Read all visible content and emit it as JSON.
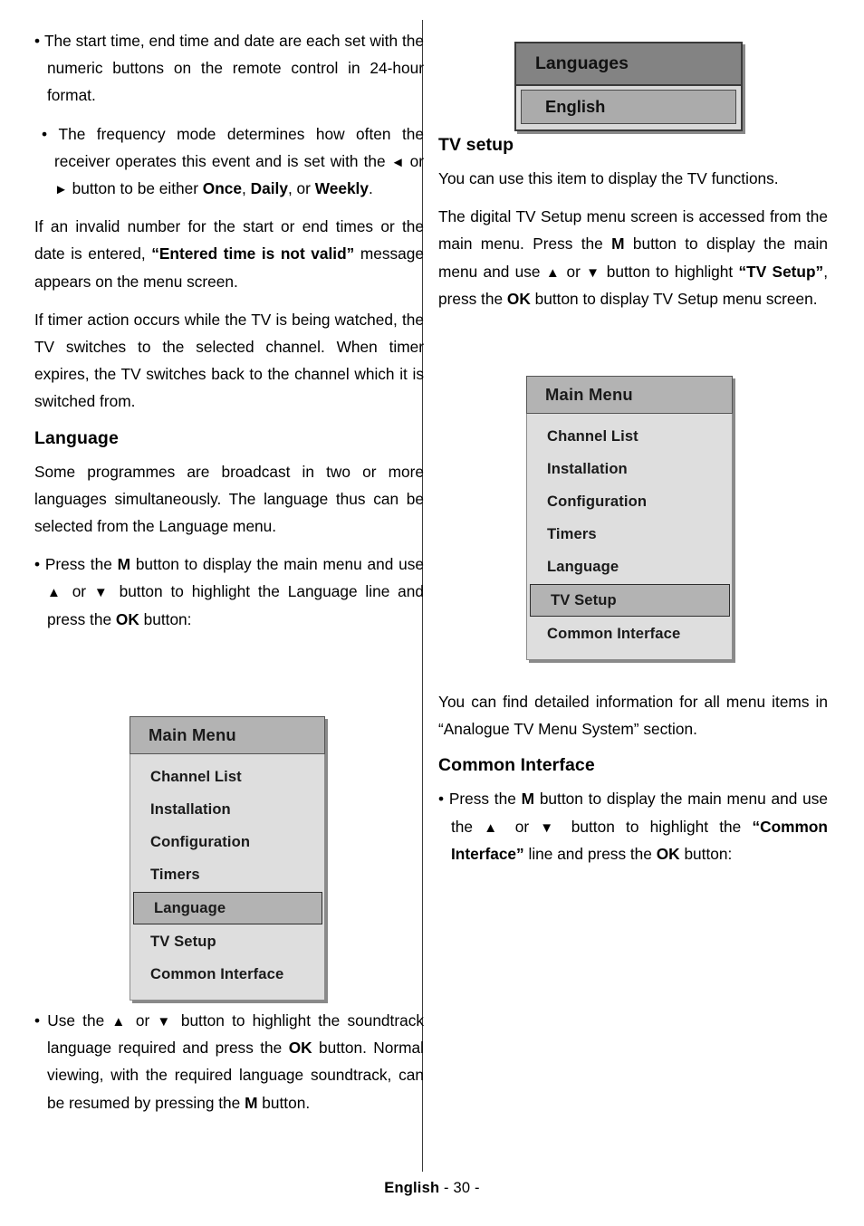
{
  "page": {
    "footer_language": "English",
    "footer_page": " - 30 -"
  },
  "left_column": {
    "b1_pre": "The start time, end time and date are each set with the numeric buttons on the remote control in 24-hour format.",
    "b2_pre": "The frequency mode determines how often the receiver operates this event and is set with the ",
    "b2_arrow_left": "◄",
    "b2_mid1": " or ",
    "b2_arrow_right": "►",
    "b2_mid2": " button to be either ",
    "b2_bold1": "Once",
    "b2_mid3": ", ",
    "b2_bold2": "Daily",
    "b2_mid4": ", or ",
    "b2_bold3": "Weekly",
    "b2_end": ".",
    "p1_pre": "If an invalid number for the start or end times or the date is entered, ",
    "p1_bold": "“Entered time is not valid”",
    "p1_post": " message appears on the menu screen.",
    "p2": "If timer action occurs while the TV is being watched, the TV switches to the selected channel. When timer expires, the TV switches back to the channel which it is switched from.",
    "heading_language": "Language",
    "p3": "Some programmes are broadcast in two or more languages simultaneously. The language thus can be selected from the Language menu.",
    "b3_pre": "Press the ",
    "b3_bold_m": "M",
    "b3_mid1": " button to display the main menu and use ",
    "b3_arrow_up": "▲",
    "b3_mid2": " or ",
    "b3_arrow_down": "▼",
    "b3_mid3": " button to highlight the Language line and press the ",
    "b3_bold_ok": "OK",
    "b3_end": " button:",
    "b4_pre": "Use the ",
    "b4_arrow_up": "▲",
    "b4_mid1": " or ",
    "b4_arrow_down": "▼",
    "b4_mid2": " button to highlight the soundtrack language required and press the ",
    "b4_bold_ok": "OK",
    "b4_mid3": " button. Normal viewing, with the required language soundtrack, can be resumed by pressing the ",
    "b4_bold_m": "M",
    "b4_end": " button."
  },
  "right_column": {
    "heading_tv_setup": "TV setup",
    "p1": "You can use this item to display the TV functions.",
    "p2_pre": "The digital TV Setup menu screen is accessed from the main menu. Press the ",
    "p2_bold_m": "M",
    "p2_mid1": " button to display the main menu and use ",
    "p2_arrow_up": "▲",
    "p2_mid2": " or ",
    "p2_arrow_down": "▼",
    "p2_mid3": " button to highlight ",
    "p2_bold_tvsetup": "“TV Setup”",
    "p2_mid4": ", press the ",
    "p2_bold_ok": "OK",
    "p2_end": " button to display TV Setup menu screen.",
    "p3": "You can find detailed information for all menu items in “Analogue TV Menu System” section.",
    "heading_common_interface": "Common Interface",
    "b1_pre": "Press the ",
    "b1_bold_m": "M",
    "b1_mid1": " button to display the main menu and use the ",
    "b1_arrow_up": "▲",
    "b1_mid2": " or ",
    "b1_arrow_down": "▼",
    "b1_mid3": " button to highlight the ",
    "b1_bold_ci": "“Common Interface”",
    "b1_mid4": " line and press the ",
    "b1_bold_ok": "OK",
    "b1_end": " button:"
  },
  "languages_osd": {
    "title": "Languages",
    "selected_value": "English"
  },
  "main_menu_left": {
    "title": "Main Menu",
    "items": [
      {
        "label": "Channel List",
        "selected": false
      },
      {
        "label": "Installation",
        "selected": false
      },
      {
        "label": "Configuration",
        "selected": false
      },
      {
        "label": "Timers",
        "selected": false
      },
      {
        "label": "Language",
        "selected": true
      },
      {
        "label": "TV Setup",
        "selected": false
      },
      {
        "label": "Common Interface",
        "selected": false
      }
    ]
  },
  "main_menu_right": {
    "title": "Main Menu",
    "items": [
      {
        "label": "Channel List",
        "selected": false
      },
      {
        "label": "Installation",
        "selected": false
      },
      {
        "label": "Configuration",
        "selected": false
      },
      {
        "label": "Timers",
        "selected": false
      },
      {
        "label": "Language",
        "selected": false
      },
      {
        "label": "TV Setup",
        "selected": true
      },
      {
        "label": "Common Interface",
        "selected": false
      }
    ]
  },
  "colors": {
    "osd_title_bg": "#b3b3b3",
    "osd_body_bg": "#dedede",
    "osd_selected_bg": "#b3b3b3",
    "lang_title_bg": "#838383",
    "lang_row_bg": "#ababab",
    "text": "#000000"
  }
}
